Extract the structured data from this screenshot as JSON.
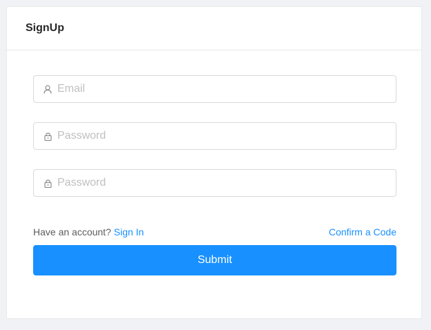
{
  "card": {
    "title": "SignUp"
  },
  "form": {
    "email": {
      "placeholder": "Email",
      "value": "",
      "icon": "user-icon"
    },
    "password": {
      "placeholder": "Password",
      "value": "",
      "icon": "lock-icon"
    },
    "confirm_password": {
      "placeholder": "Password",
      "value": "",
      "icon": "lock-icon"
    }
  },
  "links": {
    "have_account_text": "Have an account?",
    "sign_in_label": "Sign In",
    "confirm_code_label": "Confirm a Code"
  },
  "submit": {
    "label": "Submit"
  },
  "colors": {
    "primary": "#1890ff",
    "background": "#f0f2f5",
    "border": "#d9d9d9",
    "placeholder": "#bfbfbf"
  }
}
